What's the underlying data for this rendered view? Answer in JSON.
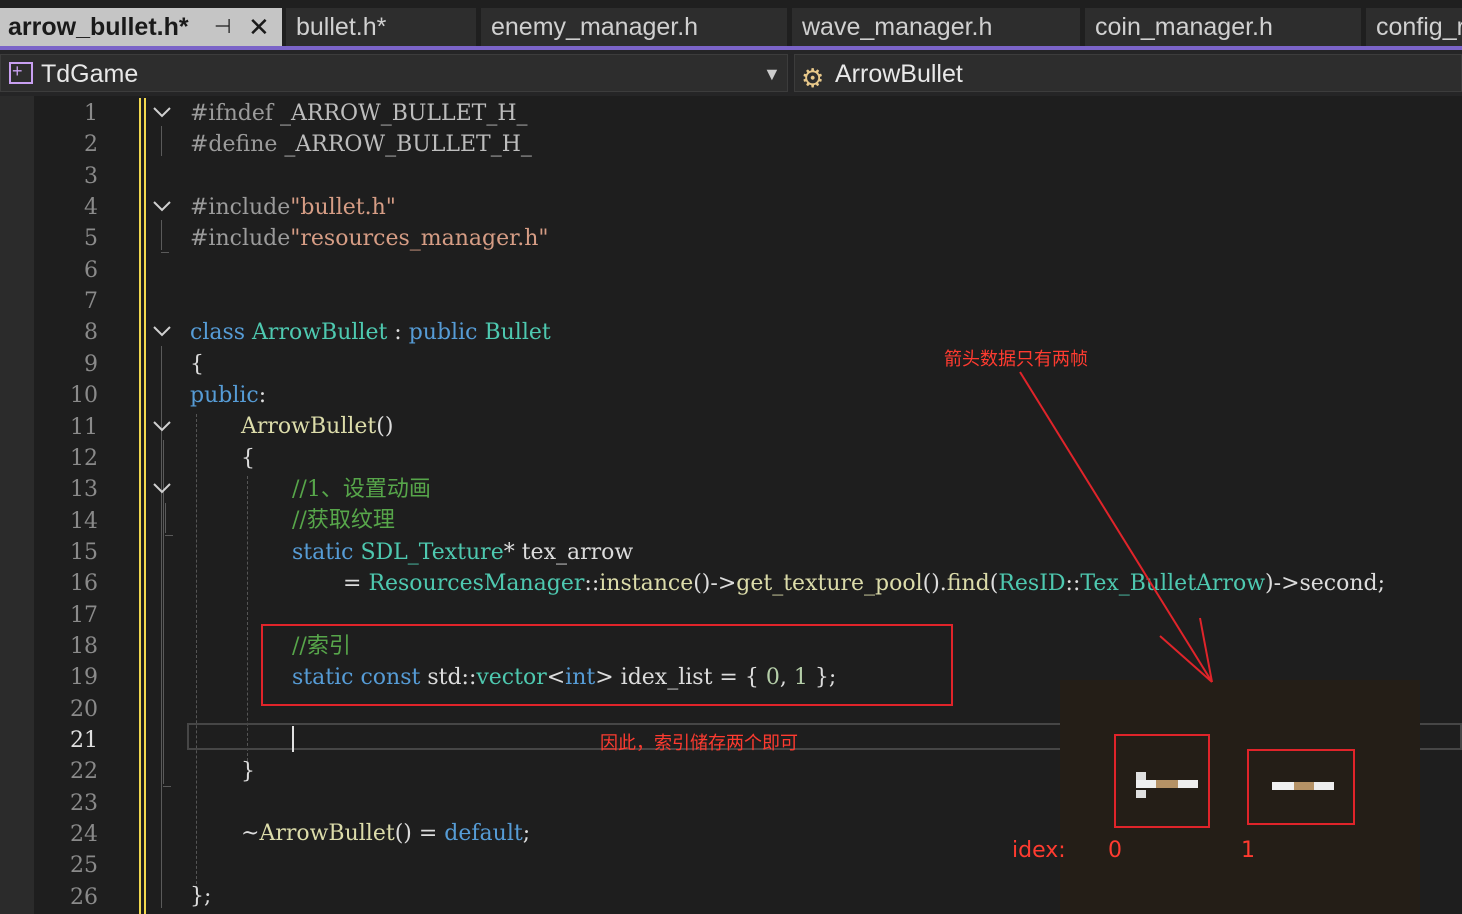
{
  "tabs": [
    {
      "label": "arrow_bullet.h*",
      "active": true
    },
    {
      "label": "bullet.h*"
    },
    {
      "label": "enemy_manager.h"
    },
    {
      "label": "wave_manager.h"
    },
    {
      "label": "coin_manager.h"
    },
    {
      "label": "config_r"
    }
  ],
  "active_tab_pin": "⊣",
  "active_tab_close": "✕",
  "nav": {
    "project": "TdGame",
    "symbol": "ArrowBullet"
  },
  "line_numbers": [
    "1",
    "2",
    "3",
    "4",
    "5",
    "6",
    "7",
    "8",
    "9",
    "10",
    "11",
    "12",
    "13",
    "14",
    "15",
    "16",
    "17",
    "18",
    "19",
    "20",
    "21",
    "22",
    "23",
    "24",
    "25",
    "26"
  ],
  "current_line": "21",
  "code": {
    "l1_a": "#ifndef ",
    "l1_b": "_ARROW_BULLET_H_",
    "l2_a": "#define ",
    "l2_b": "_ARROW_BULLET_H_",
    "l4_a": "#include",
    "l4_b": "\"bullet.h\"",
    "l5_a": "#include",
    "l5_b": "\"resources_manager.h\"",
    "l8_a": "class ",
    "l8_b": "ArrowBullet",
    "l8_c": " : ",
    "l8_d": "public ",
    "l8_e": "Bullet",
    "l9": "{",
    "l10_a": "public",
    "l10_b": ":",
    "l11_a": "ArrowBullet",
    "l11_b": "()",
    "l12": "{",
    "l13": "//1、设置动画",
    "l14": "//获取纹理",
    "l15_a": "static ",
    "l15_b": "SDL_Texture",
    "l15_c": "* ",
    "l15_d": "tex_arrow",
    "l16_a": "= ",
    "l16_b": "ResourcesManager",
    "l16_c": "::",
    "l16_d": "instance",
    "l16_e": "()->",
    "l16_f": "get_texture_pool",
    "l16_g": "().",
    "l16_h": "find",
    "l16_i": "(",
    "l16_j": "ResID",
    "l16_k": "::",
    "l16_l": "Tex_BulletArrow",
    "l16_m": ")->",
    "l16_n": "second;",
    "l18": "//索引",
    "l19_a": "static ",
    "l19_b": "const ",
    "l19_c": "std",
    "l19_d": "::",
    "l19_e": "vector",
    "l19_f": "<",
    "l19_g": "int",
    "l19_h": "> ",
    "l19_i": "idex_list",
    "l19_j": " = { ",
    "l19_k": "0",
    "l19_l": ", ",
    "l19_m": "1",
    "l19_n": " };",
    "l22": "}",
    "l24_a": "~",
    "l24_b": "ArrowBullet",
    "l24_c": "() = ",
    "l24_d": "default",
    "l24_e": ";",
    "l26": "};"
  },
  "annotations": {
    "arrow_note": "箭头数据只有两帧",
    "index_note": "因此，索引储存两个即可",
    "idex_label": "idex:",
    "frame0": "0",
    "frame1": "1"
  },
  "colors": {
    "accent": "#7b64c8",
    "annotation_red": "#e0242a",
    "keyword": "#569cd6",
    "type": "#4ec9b0",
    "comment": "#57a64a",
    "string": "#d69d85"
  },
  "icons": {
    "project": "project-icon",
    "class": "class-icon",
    "fold": "chevron-down-icon"
  }
}
